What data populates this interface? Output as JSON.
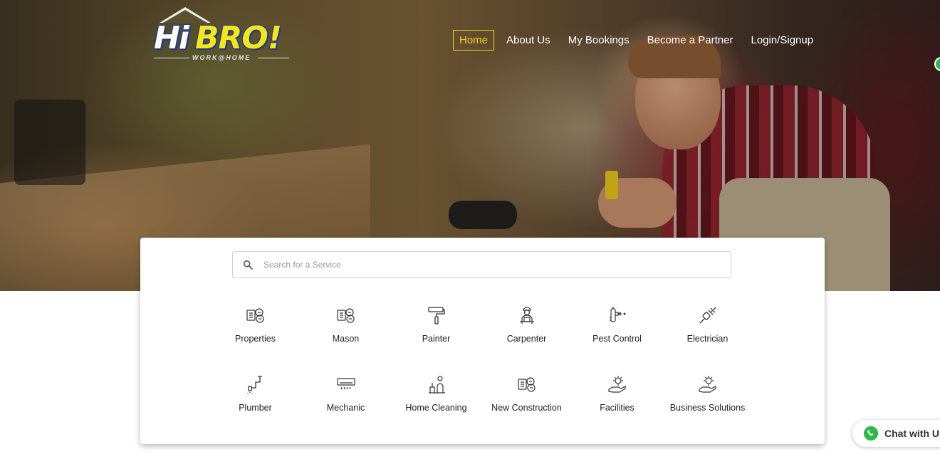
{
  "brand": {
    "logo_text_hi": "Hi",
    "logo_text_bro": "BRO!",
    "tagline": "WORK@HOME",
    "colors": {
      "yellow": "#f5e61c",
      "blue": "#1d3a8a",
      "active_nav": "#f5d11c",
      "whatsapp": "#2fb84a"
    }
  },
  "nav": {
    "items": [
      {
        "label": "Home",
        "active": true
      },
      {
        "label": "About Us"
      },
      {
        "label": "My Bookings"
      },
      {
        "label": "Become a Partner"
      },
      {
        "label": "Login/Signup"
      }
    ]
  },
  "search": {
    "placeholder": "Search for a Service",
    "icon": "search-icon"
  },
  "services": [
    {
      "label": "Properties",
      "icon": "properties-icon"
    },
    {
      "label": "Mason",
      "icon": "mason-icon"
    },
    {
      "label": "Painter",
      "icon": "paint-roller-icon"
    },
    {
      "label": "Carpenter",
      "icon": "carpenter-icon"
    },
    {
      "label": "Pest Control",
      "icon": "pest-control-icon"
    },
    {
      "label": "Electrician",
      "icon": "electric-plug-icon"
    },
    {
      "label": "Plumber",
      "icon": "plumbing-icon"
    },
    {
      "label": "Mechanic",
      "icon": "air-conditioner-icon"
    },
    {
      "label": "Home Cleaning",
      "icon": "cleaning-icon"
    },
    {
      "label": "New Construction",
      "icon": "construction-icon"
    },
    {
      "label": "Facilities",
      "icon": "gear-hand-icon"
    },
    {
      "label": "Business Solutions",
      "icon": "business-gear-icon"
    }
  ],
  "chat": {
    "label": "Chat with Us",
    "icon": "whatsapp-icon"
  }
}
